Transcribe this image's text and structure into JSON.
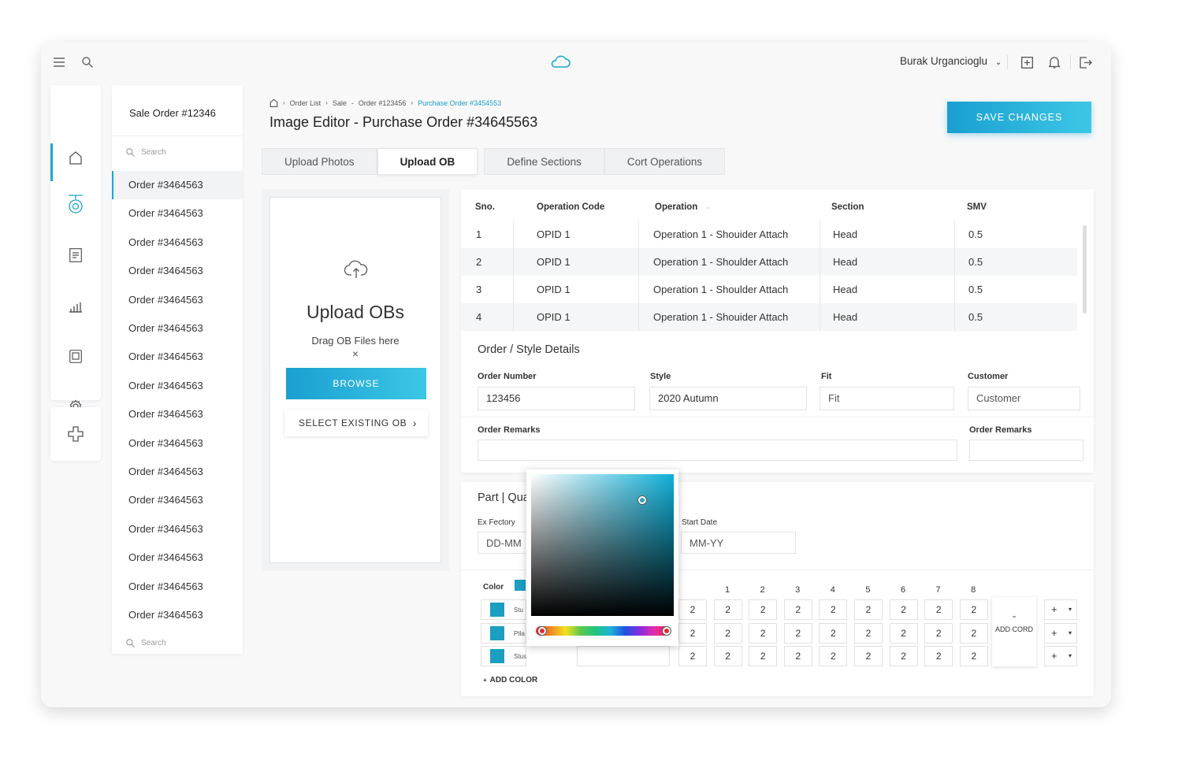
{
  "colors": {
    "accent": "#1ba7cf",
    "swatch": "#1a9fc1"
  },
  "header": {
    "user_name": "Burak Urgancioglu"
  },
  "order_list": {
    "title": "Sale Order #12346",
    "search_placeholder": "Search",
    "bottom_search": "Search",
    "items": [
      "Order #3464563",
      "Order #3464563",
      "Order #3464563",
      "Order #3464563",
      "Order #3464563",
      "Order #3464563",
      "Order #3464563",
      "Order #3464563",
      "Order #3464563",
      "Order #3464563",
      "Order #3464563",
      "Order #3464563",
      "Order #3464563",
      "Order #3464563",
      "Order #3464563",
      "Order #3464563"
    ]
  },
  "breadcrumb": {
    "items": [
      "Order List",
      "Sale",
      "Order #123456"
    ],
    "separator": "-",
    "current": "Purchase Order #3454553"
  },
  "page": {
    "title": "Image Editor - Purchase Order #34645563",
    "save_label": "SAVE CHANGES"
  },
  "tabs": [
    "Upload Photos",
    "Upload OB",
    "Define Sections",
    "Cort Operations"
  ],
  "upload": {
    "title": "Upload OBs",
    "subtitle": "Drag OB Files here",
    "close": "×",
    "browse": "BROWSE",
    "select_existing": "SELECT EXISTING OB"
  },
  "operations": {
    "headers": [
      "Sno.",
      "Operation Code",
      "Operation",
      "Section",
      "SMV"
    ],
    "rows": [
      [
        "1",
        "OPID 1",
        "Operation 1 - Shouider Attach",
        "Head",
        "0.5"
      ],
      [
        "2",
        "OPID 1",
        "Operation 1 - Shoulder Attach",
        "Head",
        "0.5"
      ],
      [
        "3",
        "OPID 1",
        "Operation 1 - Shoulder Attach",
        "Head",
        "0.5"
      ],
      [
        "4",
        "OPID 1",
        "Operation 1 - Shouider Attach",
        "Head",
        "0.5"
      ]
    ]
  },
  "details": {
    "title": "Order / Style Details",
    "order_number": {
      "label": "Order Number",
      "value": "123456"
    },
    "style": {
      "label": "Style",
      "value": "2020 Autumn"
    },
    "fit": {
      "label": "Fit",
      "placeholder": "Fit"
    },
    "customer": {
      "label": "Customer",
      "placeholder": "Customer"
    },
    "remarks1": {
      "label": "Order Remarks"
    },
    "remarks2": {
      "label": "Order Remarks"
    }
  },
  "part": {
    "title": "Part | Qua",
    "ex_factory": {
      "label": "Ex Fectory",
      "placeholder": "DD-MM"
    },
    "start_date": {
      "label": "Start Date",
      "placeholder": "MM-YY"
    },
    "color_label": "Color",
    "size_headers": [
      "1",
      "2",
      "3",
      "4",
      "5",
      "6",
      "7",
      "8"
    ],
    "rows": [
      {
        "name": "Stu",
        "values": [
          "2",
          "2",
          "2",
          "2",
          "2",
          "2",
          "2",
          "2",
          "2"
        ]
      },
      {
        "name": "Ptla",
        "values": [
          "2",
          "2",
          "2",
          "2",
          "2",
          "2",
          "2",
          "2",
          "2"
        ]
      },
      {
        "name": "Stus",
        "values": [
          "2",
          "2",
          "2",
          "2",
          "2",
          "2",
          "2",
          "2",
          "2"
        ]
      }
    ],
    "add_cord": "ADD CORD",
    "add_color": "ADD COLOR",
    "plus": "+",
    "caret": "▾"
  }
}
